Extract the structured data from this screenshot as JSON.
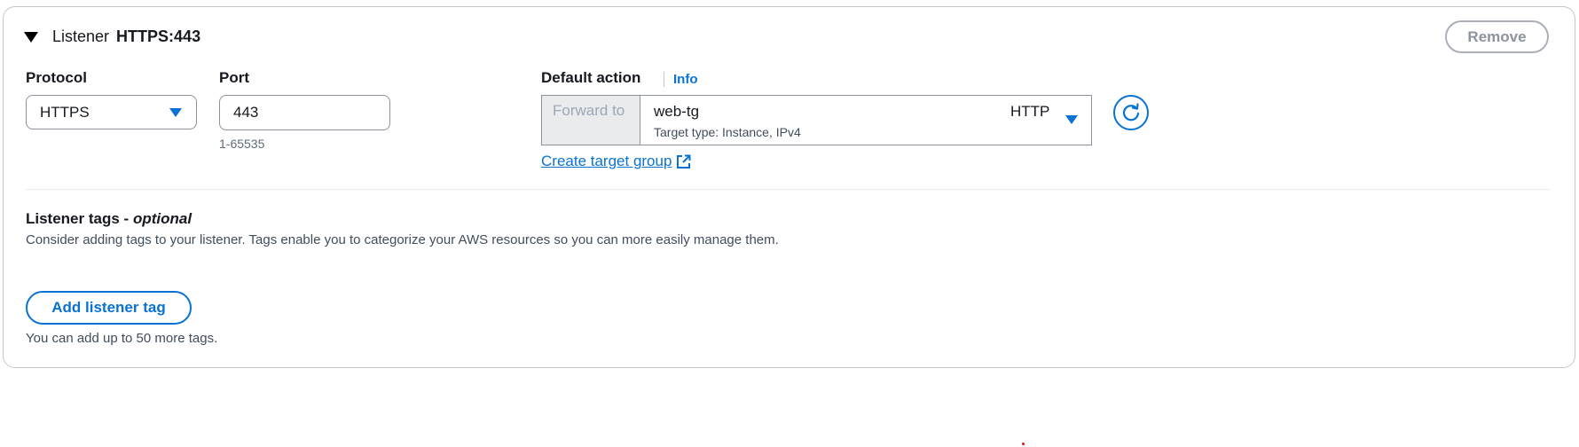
{
  "listener": {
    "label": "Listener",
    "value": "HTTPS:443",
    "remove_label": "Remove"
  },
  "protocol": {
    "label": "Protocol",
    "selected": "HTTPS"
  },
  "port": {
    "label": "Port",
    "value": "443",
    "hint": "1-65535"
  },
  "default_action": {
    "label": "Default action",
    "info_label": "Info",
    "forward_to_label": "Forward to",
    "target_group_name": "web-tg",
    "target_group_protocol": "HTTP",
    "target_group_subtitle": "Target type: Instance, IPv4",
    "create_target_group_label": "Create target group"
  },
  "tags": {
    "title": "Listener tags -",
    "title_optional": "optional",
    "description": "Consider adding tags to your listener. Tags enable you to categorize your AWS resources so you can more easily manage them.",
    "add_button_label": "Add listener tag",
    "limit_text": "You can add up to 50 more tags."
  },
  "colors": {
    "accent": "#0972d3",
    "border": "#8c939c",
    "disabled": "#9ba7b6"
  },
  "icons": {
    "expand": "caret-down-icon",
    "dropdown": "triangle-down-icon",
    "refresh": "refresh-icon",
    "external": "external-link-icon"
  }
}
